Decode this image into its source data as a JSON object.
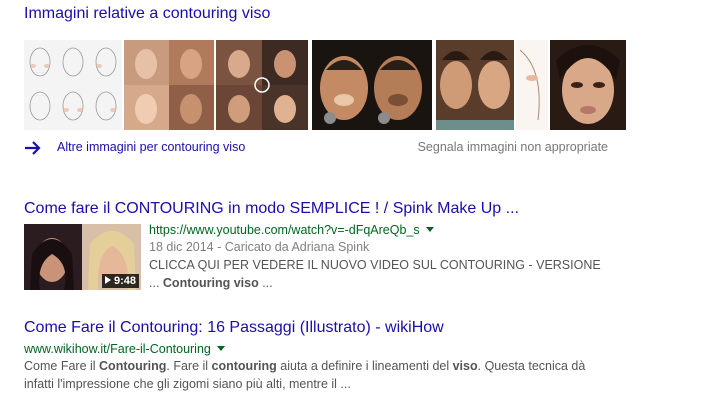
{
  "images_section": {
    "title": "Immagini relative a contouring viso",
    "more_link": "Altre immagini per contouring viso",
    "report_link": "Segnala immagini non appropriate"
  },
  "results": [
    {
      "title": "Come fare il CONTOURING in modo SEMPLICE ! / Spink Make Up ...",
      "url": "https://www.youtube.com/watch?v=-dFqAreQb_s",
      "meta": "18 dic 2014 - Caricato da Adriana Spink",
      "snippet_line1": "CLICCA QUI PER VEDERE IL NUOVO VIDEO SUL CONTOURING - VERSIONE",
      "snippet_line2_pre": "... ",
      "snippet_line2_bold": "Contouring viso",
      "snippet_line2_post": " ...",
      "duration": "9:48"
    },
    {
      "title": "Come Fare il Contouring: 16 Passaggi (Illustrato) - wikiHow",
      "url": "www.wikihow.it/Fare-il-Contouring",
      "snippet_a": "Come Fare il ",
      "snippet_b": "Contouring",
      "snippet_c": ". Fare il ",
      "snippet_d": "contouring",
      "snippet_e": " aiuta a definire i lineamenti del ",
      "snippet_f": "viso",
      "snippet_g": ". Questa tecnica dà",
      "snippet_line2": "infatti l'impressione che gli zigomi siano più alti, mentre il ..."
    }
  ],
  "colors": {
    "link": "#1a0dab",
    "url": "#006621",
    "snippet": "#545454",
    "meta": "#808080"
  }
}
